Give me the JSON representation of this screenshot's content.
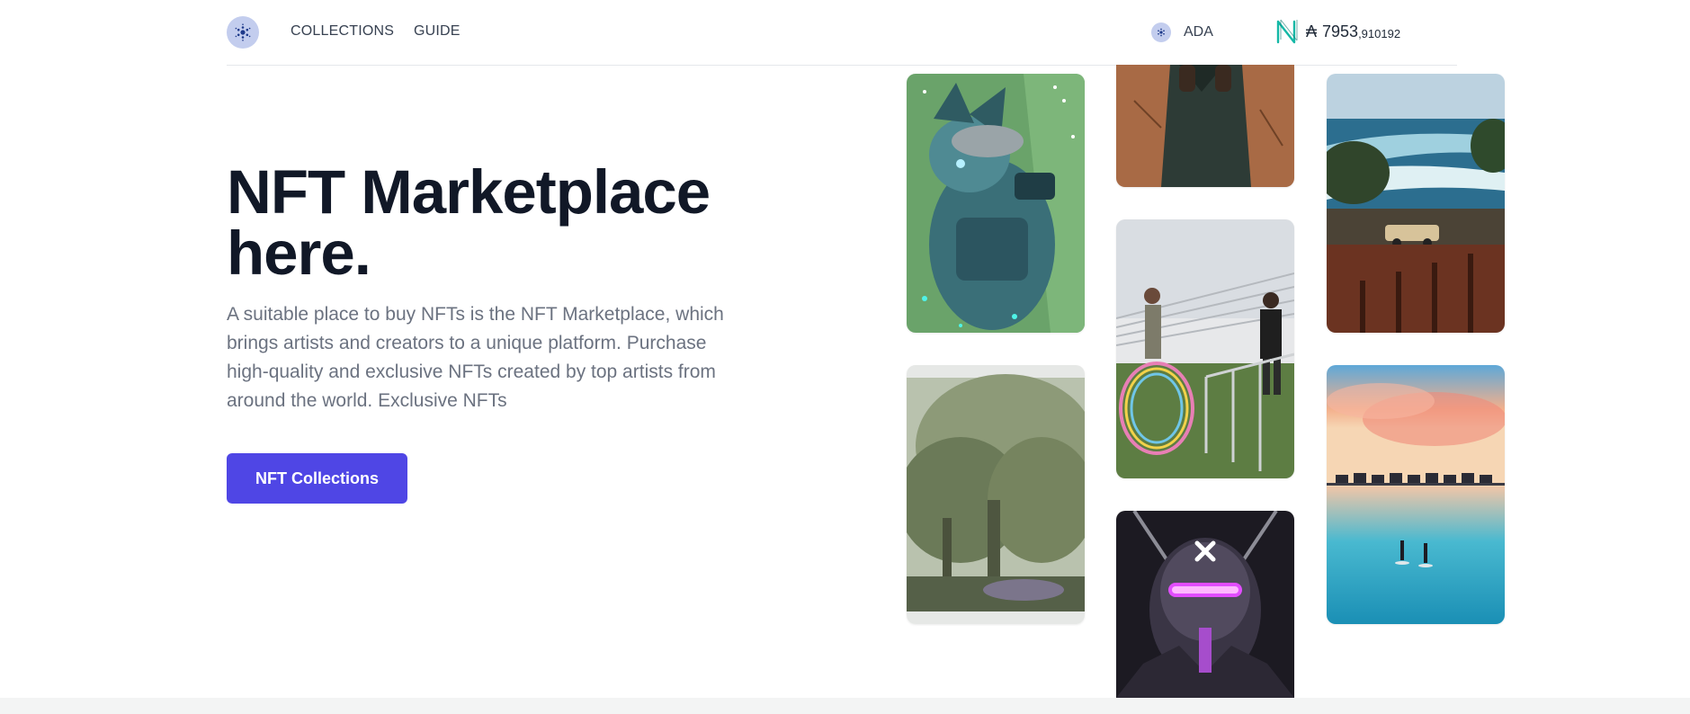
{
  "header": {
    "logo_icon": "cardano-logo-icon",
    "nav": [
      {
        "label": "COLLECTIONS"
      },
      {
        "label": "GUIDE"
      }
    ],
    "currency": {
      "icon": "cardano-icon",
      "label": "ADA"
    },
    "wallet": {
      "icon": "n-logo-icon",
      "symbol": "₳",
      "balance_int": "7953",
      "balance_dec": ",910192"
    }
  },
  "hero": {
    "title": "NFT Marketplace here.",
    "description": "A suitable place to buy NFTs is the NFT Marketplace, which brings artists and creators to a unique platform. Purchase high-quality and exclusive NFTs created by top artists from around the world. Exclusive NFTs",
    "cta_label": "NFT Collections"
  },
  "gallery": [
    {
      "subject": "cartoon-armored-fox"
    },
    {
      "subject": "misty-forest-trees"
    },
    {
      "subject": "person-in-brown-jacket"
    },
    {
      "subject": "kids-with-hula-hoops"
    },
    {
      "subject": "purple-neon-robot"
    },
    {
      "subject": "coastline-with-car"
    },
    {
      "subject": "sunset-water-bungalows"
    }
  ],
  "colors": {
    "accent": "#4f46e5",
    "title": "#111827",
    "body_text": "#6b7280",
    "logo_bg": "#c3cdee",
    "n_logo": "#14b8a6"
  }
}
